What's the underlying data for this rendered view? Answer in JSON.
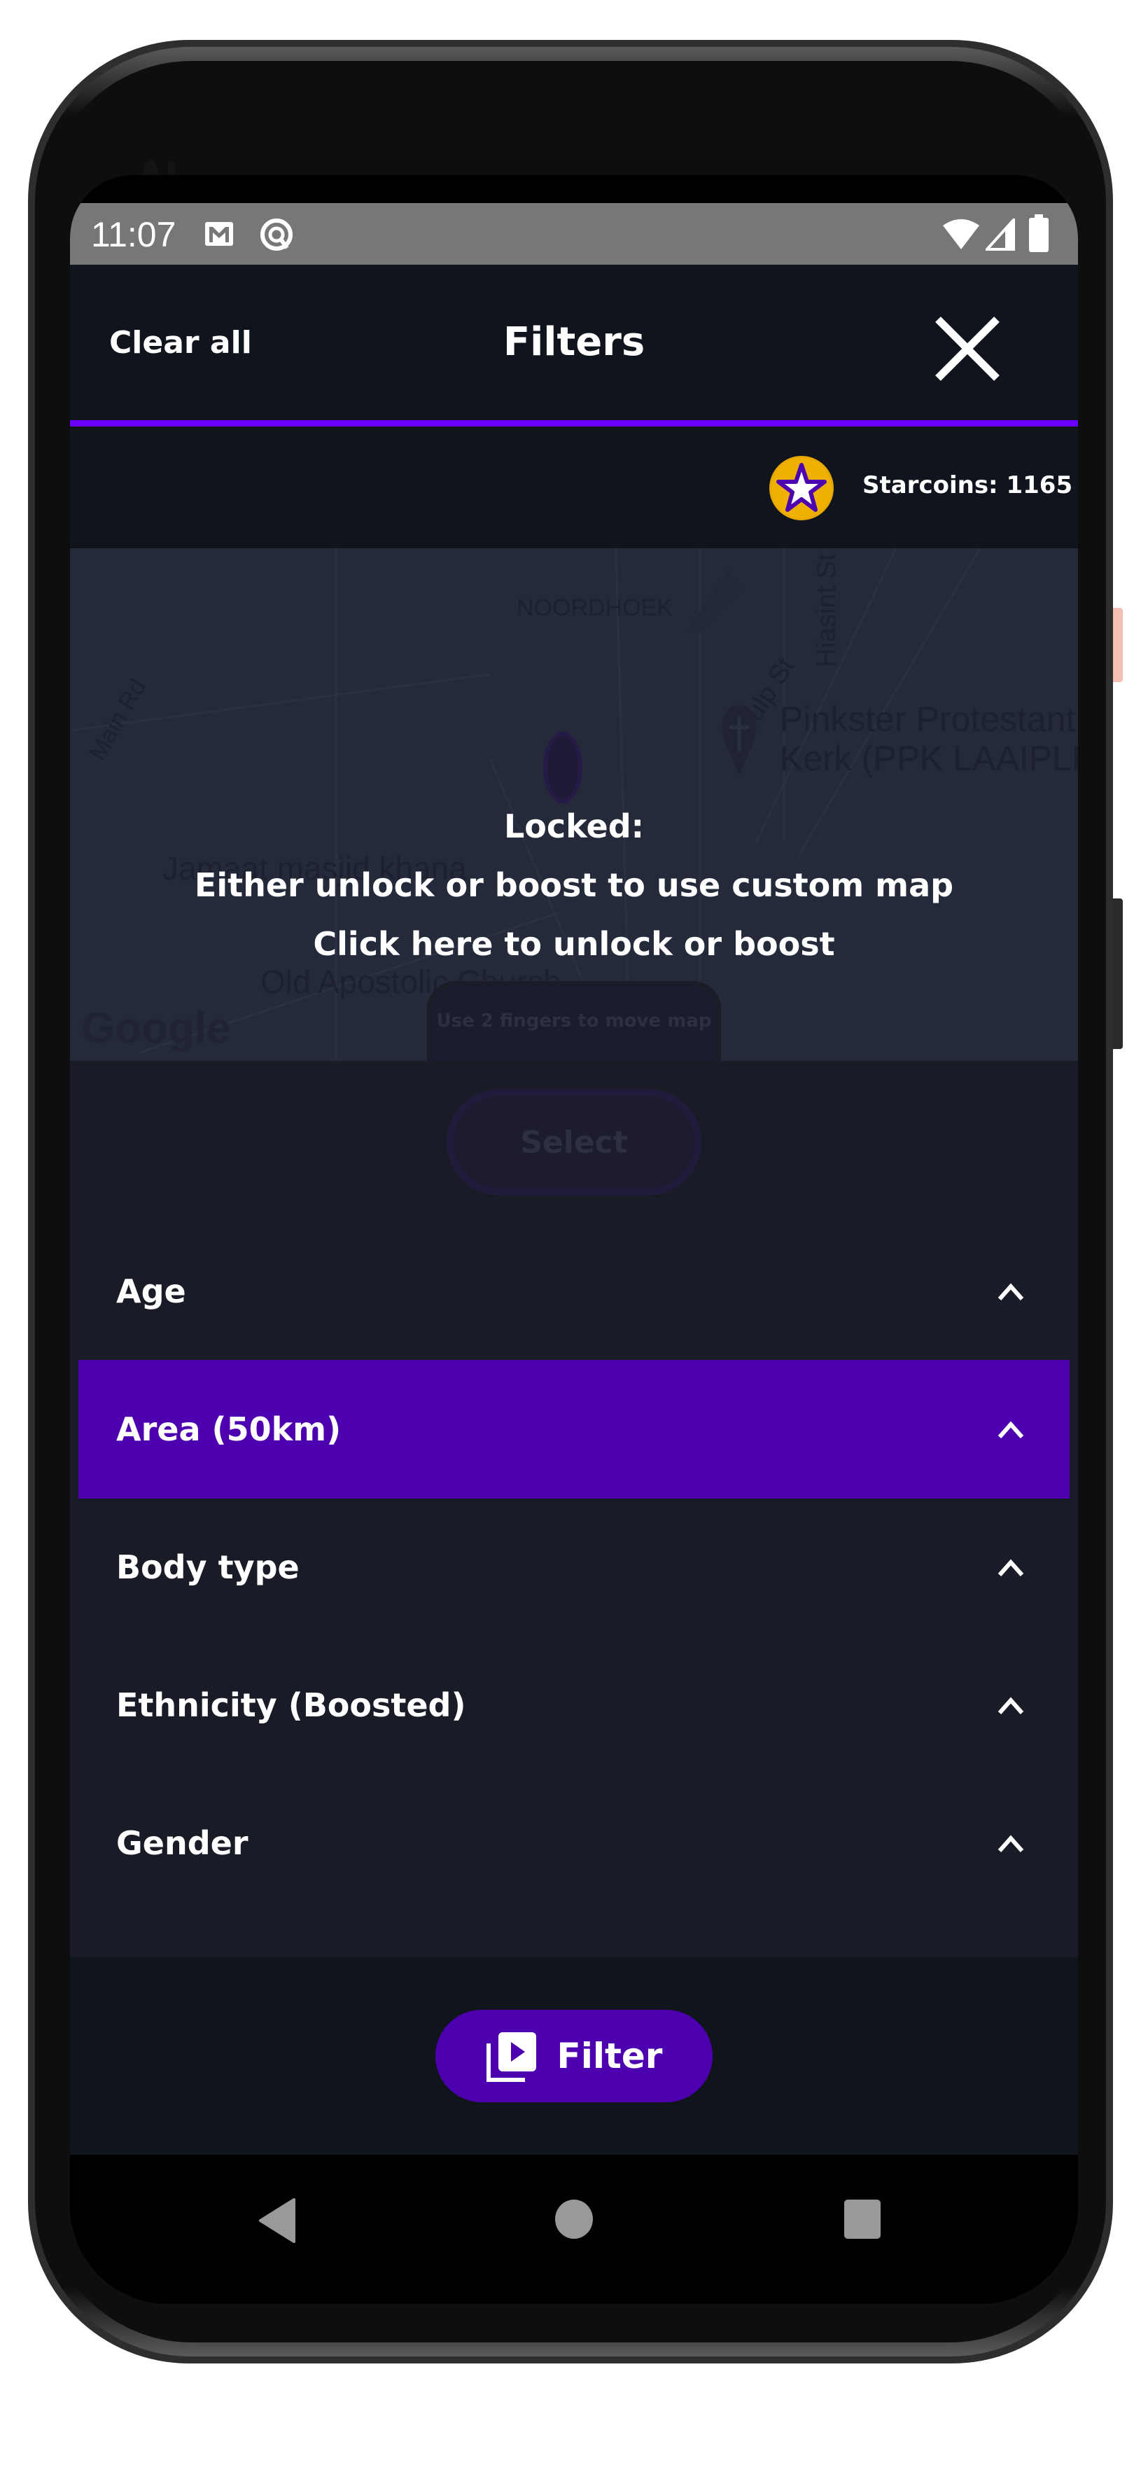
{
  "status_bar": {
    "time": "11:07",
    "left_icons": [
      "gmail-icon",
      "sync-icon"
    ],
    "right_icons": [
      "wifi-icon",
      "signal-icon",
      "battery-icon"
    ]
  },
  "header": {
    "clear_all_label": "Clear all",
    "title": "Filters",
    "close_icon": "close-icon"
  },
  "starcoins": {
    "icon": "star-coin-icon",
    "label": "Starcoins: 1165"
  },
  "map": {
    "labels": {
      "noordhoek": "NOORDHOEK",
      "main_rd": "Main Rd",
      "hiasint_st": "Hiasint St",
      "tulp_st": "Tulp St",
      "church_line1": "Pinkster Protestant",
      "church_line2": "Kerk (PPK LAAIPLE",
      "mosque": "Jamaat masjid khana",
      "apostolic": "Old Apostolic Church",
      "google": "Google"
    },
    "locked_title": "Locked:",
    "locked_message": "Either unlock or boost to use custom map",
    "unlock_link": "Click here to unlock or boost",
    "gesture_hint": "Use 2 fingers to move map"
  },
  "select_button_label": "Select",
  "accordion": {
    "items": [
      {
        "label": "Age",
        "active": false
      },
      {
        "label": "Area (50km)",
        "active": true
      },
      {
        "label": "Body type",
        "active": false
      },
      {
        "label": "Ethnicity (Boosted)",
        "active": false
      },
      {
        "label": "Gender",
        "active": false
      }
    ]
  },
  "filter_button_label": "Filter",
  "colors": {
    "accent": "#6c00ff",
    "active_row": "#4c00b0",
    "header_bg": "#10141c",
    "list_bg": "#191c26",
    "coin": "#f0b000"
  },
  "nav": {
    "back": "back-icon",
    "home": "home-icon",
    "recents": "recents-icon"
  }
}
